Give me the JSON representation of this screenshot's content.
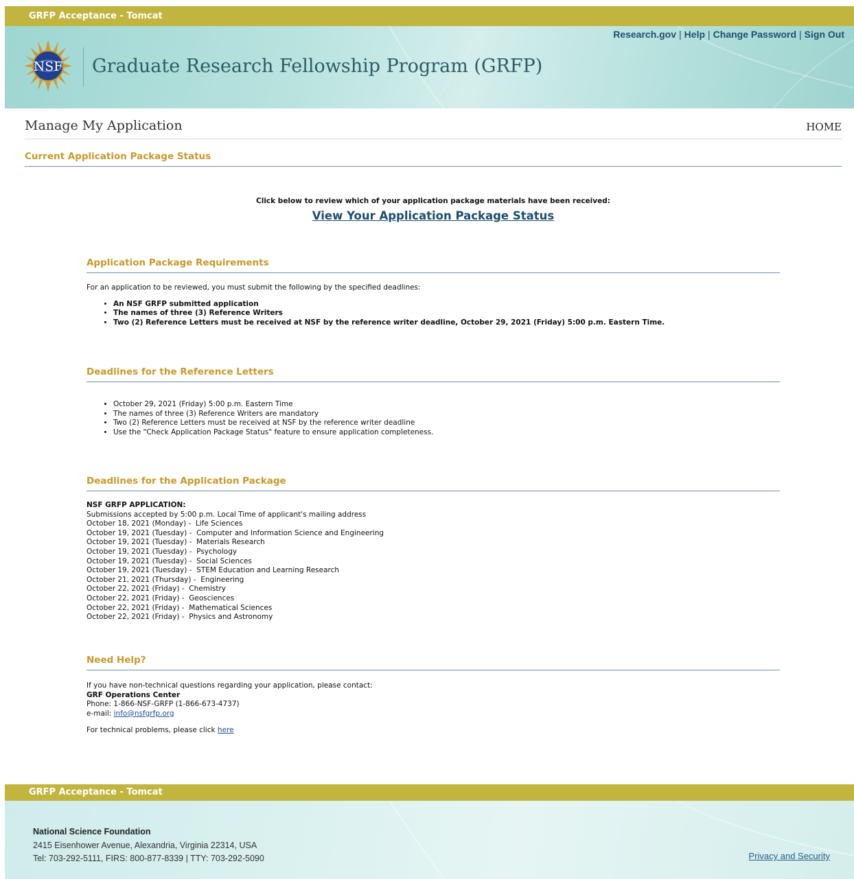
{
  "environment_label": "GRFP Acceptance - Tomcat",
  "header": {
    "logo_text": "NSF",
    "title": "Graduate Research Fellowship Program (GRFP)",
    "links": [
      "Research.gov",
      "Help",
      "Change Password",
      "Sign Out"
    ]
  },
  "page": {
    "title": "Manage My Application",
    "home_label": "HOME",
    "current_status_heading": "Current Application Package Status",
    "review_note": "Click below to review which of your application package materials have been received:",
    "view_status_link": "View Your Application Package Status"
  },
  "requirements": {
    "heading": "Application Package Requirements",
    "intro": "For an application to be reviewed, you must submit the following by the specified deadlines:",
    "items": [
      "An NSF GRFP submitted application",
      "The names of three (3) Reference Writers",
      "Two (2) Reference Letters must be received at NSF by the reference writer deadline, October 29, 2021 (Friday) 5:00 p.m. Eastern Time."
    ]
  },
  "reference_deadlines": {
    "heading": "Deadlines for the Reference Letters",
    "items": [
      "October 29, 2021 (Friday) 5:00 p.m. Eastern Time",
      "The names of three (3) Reference Writers are mandatory",
      "Two (2) Reference Letters must be received at NSF by the reference writer deadline",
      "Use the \"Check Application Package Status\" feature to ensure application completeness."
    ]
  },
  "package_deadlines": {
    "heading": "Deadlines for the Application Package",
    "label": "NSF GRFP APPLICATION:",
    "note": "Submissions accepted by 5:00 p.m. Local Time of applicant's mailing address",
    "lines": [
      "October 18, 2021 (Monday) -  Life Sciences",
      "October 19, 2021 (Tuesday) -  Computer and Information Science and Engineering",
      "October 19, 2021 (Tuesday) -  Materials Research",
      "October 19, 2021 (Tuesday) -  Psychology",
      "October 19, 2021 (Tuesday) -  Social Sciences",
      "October 19, 2021 (Tuesday) -  STEM Education and Learning Research",
      "October 21, 2021 (Thursday) -  Engineering",
      "October 22, 2021 (Friday) -  Chemistry",
      "October 22, 2021 (Friday) -  Geosciences",
      "October 22, 2021 (Friday) -  Mathematical Sciences",
      "October 22, 2021 (Friday) -  Physics and Astronomy"
    ]
  },
  "help": {
    "heading": "Need Help?",
    "intro": "If you have non-technical questions regarding your application, please contact:",
    "center": "GRF Operations Center",
    "phone": "Phone: 1-866-NSF-GRFP (1-866-673-4737)",
    "email_prefix": "e-mail: ",
    "email": "info@nsfgrfp.org",
    "tech_prefix": "For technical problems, please click ",
    "tech_link": "here"
  },
  "footer": {
    "org": "National Science Foundation",
    "address": "2415 Eisenhower Avenue, Alexandria, Virginia 22314, USA",
    "phones": "Tel: 703-292-5111, FIRS: 800-877-8339 | TTY: 703-292-5090",
    "privacy": "Privacy and Security"
  },
  "colors": {
    "gold_bar": "#c1b53f",
    "heading_gold": "#c79a2c",
    "link_blue": "#1d4e6b"
  }
}
